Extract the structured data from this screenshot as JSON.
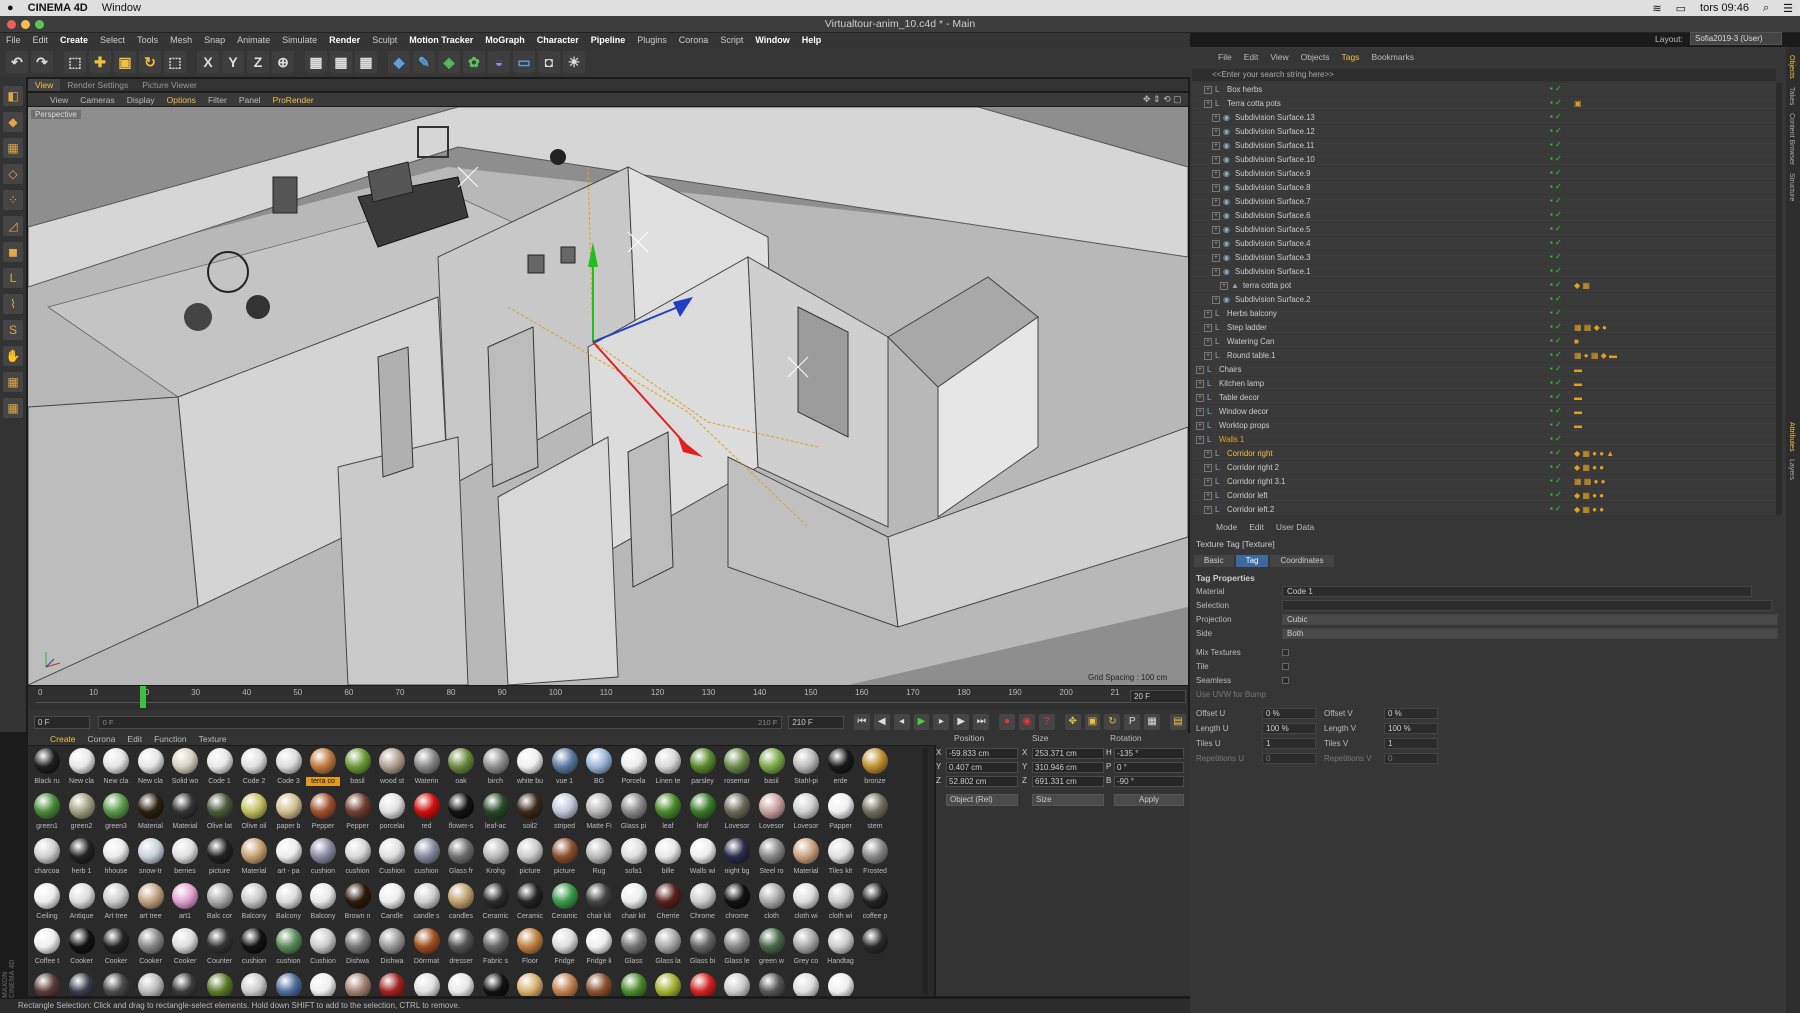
{
  "mac_menu": {
    "app": "CINEMA 4D",
    "items": [
      "Window"
    ],
    "status_right": {
      "time": "tors 09:46"
    }
  },
  "window": {
    "title": "Virtualtour-anim_10.c4d * - Main",
    "layout_label": "Layout:",
    "layout_value": "Sofia2019-3 (User)"
  },
  "menu": [
    "File",
    "Edit",
    "Create",
    "Select",
    "Tools",
    "Mesh",
    "Snap",
    "Animate",
    "Simulate",
    "Render",
    "Sculpt",
    "Motion Tracker",
    "MoGraph",
    "Character",
    "Pipeline",
    "Plugins",
    "Corona",
    "Script",
    "Window",
    "Help"
  ],
  "toolbar_axis": [
    "X",
    "Y",
    "Z"
  ],
  "viewport": {
    "tabs": [
      "View",
      "Render Settings",
      "Picture Viewer"
    ],
    "menu": [
      "View",
      "Cameras",
      "Display",
      "Options",
      "Filter",
      "Panel",
      "ProRender"
    ],
    "label": "Perspective",
    "grid_spacing": "Grid Spacing : 100 cm"
  },
  "timeline": {
    "ticks": [
      "0",
      "10",
      "20",
      "30",
      "40",
      "50",
      "60",
      "70",
      "80",
      "90",
      "100",
      "110",
      "120",
      "130",
      "140",
      "150",
      "160",
      "170",
      "180",
      "190",
      "200",
      "21"
    ],
    "current": "20 F",
    "start": "0 F",
    "start2": "0 F",
    "end_a": "210 F",
    "end_b": "210 F"
  },
  "materials": {
    "menu": [
      "Create",
      "Corona",
      "Edit",
      "Function",
      "Texture"
    ],
    "items": [
      {
        "n": "Black ru",
        "c": "#1e1e1e"
      },
      {
        "n": "New cla",
        "c": "#e8e8e8"
      },
      {
        "n": "New cla",
        "c": "#e4e4e4"
      },
      {
        "n": "New cla",
        "c": "#e6e6e6"
      },
      {
        "n": "Solid wo",
        "c": "#d8d0c0"
      },
      {
        "n": "Code 1",
        "c": "#e8e8e8"
      },
      {
        "n": "Code 2",
        "c": "#e0e0e0"
      },
      {
        "n": "Code 3",
        "c": "#dcdcdc"
      },
      {
        "n": "terra co",
        "c": "#c07a40",
        "hl": true
      },
      {
        "n": "basil",
        "c": "#6a9a3a"
      },
      {
        "n": "wood st",
        "c": "#b0a090"
      },
      {
        "n": "Waterin",
        "c": "#888"
      },
      {
        "n": "oak",
        "c": "#6a8a40"
      },
      {
        "n": "birch",
        "c": "#909090"
      },
      {
        "n": "white bu",
        "c": "#f0f0f0"
      },
      {
        "n": "vue 1",
        "c": "#5a7aa0"
      },
      {
        "n": "BG",
        "c": "#9ab6d8"
      },
      {
        "n": "Porcela",
        "c": "#ededed"
      },
      {
        "n": "Linen te",
        "c": "#d8d8d8"
      },
      {
        "n": "parsley",
        "c": "#5a8a30"
      },
      {
        "n": "rosemar",
        "c": "#6a8a4a"
      },
      {
        "n": "basil",
        "c": "#7aaa4a"
      },
      {
        "n": "Stahl-pi",
        "c": "#bbb"
      },
      {
        "n": "erde",
        "c": "#181818"
      },
      {
        "n": "bronze",
        "c": "#c09030"
      },
      {
        "n": "green1",
        "c": "#4a8a3a"
      },
      {
        "n": "green2",
        "c": "#a0a080"
      },
      {
        "n": "green3",
        "c": "#5a9a4a"
      },
      {
        "n": "Material",
        "c": "#2a2010"
      },
      {
        "n": "Material",
        "c": "#333"
      },
      {
        "n": "Olive lat",
        "c": "#4a5a3a"
      },
      {
        "n": "Olive oil",
        "c": "#c0c060"
      },
      {
        "n": "paper b",
        "c": "#d0c090"
      },
      {
        "n": "Pepper",
        "c": "#a05030"
      },
      {
        "n": "Pepper",
        "c": "#704030"
      },
      {
        "n": "porcelai",
        "c": "#e0e0e0"
      },
      {
        "n": "red",
        "c": "#d01010"
      },
      {
        "n": "flower-s",
        "c": "#111"
      },
      {
        "n": "leaf-ac",
        "c": "#2a4a2a"
      },
      {
        "n": "soil2",
        "c": "#3a2a1a"
      },
      {
        "n": "striped",
        "c": "#c0c8d8"
      },
      {
        "n": "Matte Fi",
        "c": "#b8b8b8"
      },
      {
        "n": "Glass pi",
        "c": "#8a8a8a"
      },
      {
        "n": "leaf",
        "c": "#4a8a2a"
      },
      {
        "n": "leaf",
        "c": "#3a7a2a"
      },
      {
        "n": "Lovesor",
        "c": "#6a6a5a"
      },
      {
        "n": "Lovesor",
        "c": "#c8a0a0"
      },
      {
        "n": "Lovesor",
        "c": "#d0d0d0"
      },
      {
        "n": "Papper",
        "c": "#f0f0f0"
      },
      {
        "n": "stem",
        "c": "#707060"
      },
      {
        "n": "charcoa",
        "c": "#d0d0d0"
      },
      {
        "n": "herb 1",
        "c": "#222"
      },
      {
        "n": "hhouse",
        "c": "#ececec"
      },
      {
        "n": "snow-tr",
        "c": "#c8d0d8"
      },
      {
        "n": "berries",
        "c": "#e0e0e0"
      },
      {
        "n": "picture",
        "c": "#222"
      },
      {
        "n": "Material",
        "c": "#c8a070"
      },
      {
        "n": "art - pa",
        "c": "#ededed"
      },
      {
        "n": "cushion",
        "c": "#8a8aa0"
      },
      {
        "n": "cushion",
        "c": "#d8d8d8"
      },
      {
        "n": "Cushion",
        "c": "#e0e0e0"
      },
      {
        "n": "cushion",
        "c": "#8888a0"
      },
      {
        "n": "Glass fr",
        "c": "#707070"
      },
      {
        "n": "Krohg",
        "c": "#bbb"
      },
      {
        "n": "picture",
        "c": "#ccc"
      },
      {
        "n": "picture",
        "c": "#8a5030"
      },
      {
        "n": "Rug",
        "c": "#bbb"
      },
      {
        "n": "sofa1",
        "c": "#ddd"
      },
      {
        "n": "bille",
        "c": "#e8e8e8"
      },
      {
        "n": "Walls wi",
        "c": "#eee"
      },
      {
        "n": "night bg",
        "c": "#2a2a4a"
      },
      {
        "n": "Steel ro",
        "c": "#888"
      },
      {
        "n": "Material",
        "c": "#caa080"
      },
      {
        "n": "Tiles kit",
        "c": "#e0e0e0"
      },
      {
        "n": "Frosted",
        "c": "#888"
      },
      {
        "n": "Ceiling",
        "c": "#eee"
      },
      {
        "n": "Antique",
        "c": "#ddd"
      },
      {
        "n": "Art tree",
        "c": "#ccc"
      },
      {
        "n": "art tree",
        "c": "#c0a080"
      },
      {
        "n": "art1",
        "c": "#e0a0d0"
      },
      {
        "n": "Balc cor",
        "c": "#aaa"
      },
      {
        "n": "Balcony",
        "c": "#c8c8c8"
      },
      {
        "n": "Balcony",
        "c": "#ddd"
      },
      {
        "n": "Balcony",
        "c": "#e8e8e8"
      },
      {
        "n": "Brown n",
        "c": "#2a1a0a"
      },
      {
        "n": "Candle",
        "c": "#eee"
      },
      {
        "n": "candle s",
        "c": "#d0d0d0"
      },
      {
        "n": "candles",
        "c": "#c0a070"
      },
      {
        "n": "Ceramic",
        "c": "#2a2a2a"
      },
      {
        "n": "Ceramic",
        "c": "#222"
      },
      {
        "n": "Ceramic",
        "c": "#3a9a4a"
      },
      {
        "n": "chair kit",
        "c": "#444"
      },
      {
        "n": "chair kit",
        "c": "#eee"
      },
      {
        "n": "Cherrie",
        "c": "#5a2020"
      },
      {
        "n": "Chrome",
        "c": "#ccc"
      },
      {
        "n": "chrome",
        "c": "#111"
      },
      {
        "n": "cloth",
        "c": "#aaa"
      },
      {
        "n": "cloth wi",
        "c": "#ddd"
      },
      {
        "n": "cloth wi",
        "c": "#ccc"
      },
      {
        "n": "coffee p",
        "c": "#222"
      },
      {
        "n": "Coffee t",
        "c": "#eee"
      },
      {
        "n": "Cooker",
        "c": "#111"
      },
      {
        "n": "Cooker",
        "c": "#222"
      },
      {
        "n": "Cooker",
        "c": "#888"
      },
      {
        "n": "Cooker",
        "c": "#ddd"
      },
      {
        "n": "Counter",
        "c": "#333"
      },
      {
        "n": "cushion",
        "c": "#111"
      },
      {
        "n": "cushion",
        "c": "#5a8a5a"
      },
      {
        "n": "Cushion",
        "c": "#ccc"
      },
      {
        "n": "Dishwa",
        "c": "#777"
      },
      {
        "n": "Dishwa",
        "c": "#999"
      },
      {
        "n": "Dörrmat",
        "c": "#a05020"
      },
      {
        "n": "dresser",
        "c": "#555"
      },
      {
        "n": "Fabric s",
        "c": "#666"
      },
      {
        "n": "Floor",
        "c": "#c08040"
      },
      {
        "n": "Fridge",
        "c": "#ddd"
      },
      {
        "n": "Fridge li",
        "c": "#eee"
      },
      {
        "n": "Glass",
        "c": "#777"
      },
      {
        "n": "Glass la",
        "c": "#aaa"
      },
      {
        "n": "Glass bi",
        "c": "#666"
      },
      {
        "n": "Glass le",
        "c": "#888"
      },
      {
        "n": "green w",
        "c": "#4a6a4a"
      },
      {
        "n": "Grey co",
        "c": "#aaa"
      },
      {
        "n": "Handtag",
        "c": "#ccc"
      },
      {
        "n": "",
        "c": "#2a2a2a"
      },
      {
        "n": "",
        "c": "#5a3a3a"
      },
      {
        "n": "",
        "c": "#3a3a4a"
      },
      {
        "n": "",
        "c": "#4a4a4a"
      },
      {
        "n": "",
        "c": "#bbb"
      },
      {
        "n": "",
        "c": "#3a3a3a"
      },
      {
        "n": "",
        "c": "#5a7a2a"
      },
      {
        "n": "",
        "c": "#ccc"
      },
      {
        "n": "",
        "c": "#4a6a9a"
      },
      {
        "n": "",
        "c": "#eee"
      },
      {
        "n": "",
        "c": "#a08070"
      },
      {
        "n": "",
        "c": "#a02020"
      },
      {
        "n": "",
        "c": "#e0e0e0"
      },
      {
        "n": "",
        "c": "#e8e8e8"
      },
      {
        "n": "",
        "c": "#111"
      },
      {
        "n": "",
        "c": "#d8b070"
      },
      {
        "n": "",
        "c": "#c08050"
      },
      {
        "n": "",
        "c": "#8a5030"
      },
      {
        "n": "",
        "c": "#4a8a2a"
      },
      {
        "n": "",
        "c": "#a0b030"
      },
      {
        "n": "",
        "c": "#d02020"
      },
      {
        "n": "",
        "c": "#ccc"
      },
      {
        "n": "",
        "c": "#555"
      },
      {
        "n": "",
        "c": "#ddd"
      },
      {
        "n": "",
        "c": "#eee"
      }
    ]
  },
  "coords": {
    "headers": [
      "Position",
      "Size",
      "Rotation"
    ],
    "rows": [
      {
        "axis": "X",
        "pos": "-59.833 cm",
        "sz": "X",
        "size": "253.371 cm",
        "ra": "H",
        "rot": "-135 °"
      },
      {
        "axis": "Y",
        "pos": "0.407 cm",
        "sz": "Y",
        "size": "310.946 cm",
        "ra": "P",
        "rot": "0 °"
      },
      {
        "axis": "Z",
        "pos": "52.802 cm",
        "sz": "Z",
        "size": "691.331 cm",
        "ra": "B",
        "rot": "-90 °"
      }
    ],
    "mode1": "Object (Rel)",
    "mode2": "Size",
    "apply": "Apply"
  },
  "status": "Rectangle Selection: Click and drag to rectangle-select elements. Hold down SHIFT to add to the selection, CTRL to remove.",
  "maxon": "MAXON CINEMA 4D",
  "objects": {
    "menu": [
      "File",
      "Edit",
      "View",
      "Objects",
      "Tags",
      "Bookmarks"
    ],
    "search": "<<Enter your search string here>>",
    "rows": [
      {
        "n": "Box herbs",
        "d": 1,
        "tags": ""
      },
      {
        "n": "Terra cotta pots",
        "d": 1,
        "tags": "▣"
      },
      {
        "n": "Subdivision Surface.13",
        "d": 2,
        "tags": ""
      },
      {
        "n": "Subdivision Surface.12",
        "d": 2,
        "tags": ""
      },
      {
        "n": "Subdivision Surface.11",
        "d": 2,
        "tags": ""
      },
      {
        "n": "Subdivision Surface.10",
        "d": 2,
        "tags": ""
      },
      {
        "n": "Subdivision Surface.9",
        "d": 2,
        "tags": ""
      },
      {
        "n": "Subdivision Surface.8",
        "d": 2,
        "tags": ""
      },
      {
        "n": "Subdivision Surface.7",
        "d": 2,
        "tags": ""
      },
      {
        "n": "Subdivision Surface.6",
        "d": 2,
        "tags": ""
      },
      {
        "n": "Subdivision Surface.5",
        "d": 2,
        "tags": ""
      },
      {
        "n": "Subdivision Surface.4",
        "d": 2,
        "tags": ""
      },
      {
        "n": "Subdivision Surface.3",
        "d": 2,
        "tags": ""
      },
      {
        "n": "Subdivision Surface.1",
        "d": 2,
        "tags": ""
      },
      {
        "n": "terra cotta pot",
        "d": 3,
        "tags": "◆ ▦"
      },
      {
        "n": "Subdivision Surface.2",
        "d": 2,
        "tags": ""
      },
      {
        "n": "Herbs balcony",
        "d": 1,
        "tags": ""
      },
      {
        "n": "Step ladder",
        "d": 1,
        "tags": "▦ ▦ ◆ ●"
      },
      {
        "n": "Watering Can",
        "d": 1,
        "tags": "■"
      },
      {
        "n": "Round table.1",
        "d": 1,
        "tags": "▦ ● ▦ ◆ ▬"
      },
      {
        "n": "Chairs",
        "d": 0,
        "tags": "▬"
      },
      {
        "n": "Kitchen lamp",
        "d": 0,
        "tags": "▬"
      },
      {
        "n": "Table decor",
        "d": 0,
        "tags": "▬"
      },
      {
        "n": "Window decor",
        "d": 0,
        "tags": "▬"
      },
      {
        "n": "Worktop props",
        "d": 0,
        "tags": "▬"
      },
      {
        "n": "Walls 1",
        "d": 0,
        "tags": "",
        "cls": "orange"
      },
      {
        "n": "Corridor right",
        "d": 1,
        "tags": "◆ ▦ ● ● ▲",
        "cls": "sel"
      },
      {
        "n": "Corridor right 2",
        "d": 1,
        "tags": "◆ ▦ ● ●"
      },
      {
        "n": "Corridor right 3.1",
        "d": 1,
        "tags": "▦ ▦ ● ●"
      },
      {
        "n": "Corridor left",
        "d": 1,
        "tags": "◆ ▦ ● ●"
      },
      {
        "n": "Corridor left.2",
        "d": 1,
        "tags": "◆ ▦ ● ●"
      }
    ]
  },
  "attributes": {
    "menu": [
      "Mode",
      "Edit",
      "User Data"
    ],
    "title": "Texture Tag [Texture]",
    "tabs": [
      "Basic",
      "Tag",
      "Coordinates"
    ],
    "section": "Tag Properties",
    "material_label": "Material",
    "material_value": "Code 1",
    "selection_label": "Selection",
    "projection_label": "Projection",
    "projection_value": "Cubic",
    "side_label": "Side",
    "side_value": "Both",
    "mix_label": "Mix Textures",
    "tile_label": "Tile",
    "seamless_label": "Seamless",
    "uvw_label": "Use UVW for Bump",
    "offset_u": "Offset U",
    "offset_u_val": "0 %",
    "offset_v": "Offset V",
    "offset_v_val": "0 %",
    "length_u": "Length U",
    "length_u_val": "100 %",
    "length_v": "Length V",
    "length_v_val": "100 %",
    "tiles_u": "Tiles U",
    "tiles_u_val": "1",
    "tiles_v": "Tiles V",
    "tiles_v_val": "1",
    "rep_u": "Repetitions U",
    "rep_u_val": "0",
    "rep_v": "Repetitions V",
    "rep_v_val": "0"
  },
  "right_strip": [
    "Objects",
    "Takes",
    "Content Browser",
    "Structure",
    "Attributes",
    "Layers"
  ]
}
